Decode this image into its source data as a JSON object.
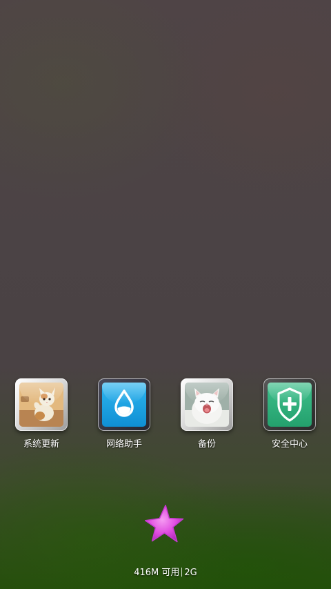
{
  "apps": [
    {
      "label": "系统更新",
      "icon": "cat-photo-icon"
    },
    {
      "label": "网络助手",
      "icon": "water-drop-icon"
    },
    {
      "label": "备份",
      "icon": "white-kitten-photo-icon"
    },
    {
      "label": "安全中心",
      "icon": "shield-plus-icon"
    }
  ],
  "status": {
    "memory": "416M 可用",
    "network": "2G"
  },
  "colors": {
    "drop_blue": "#1aa3e6",
    "shield_green": "#2fb27e",
    "star_magenta": "#e04ee0"
  }
}
